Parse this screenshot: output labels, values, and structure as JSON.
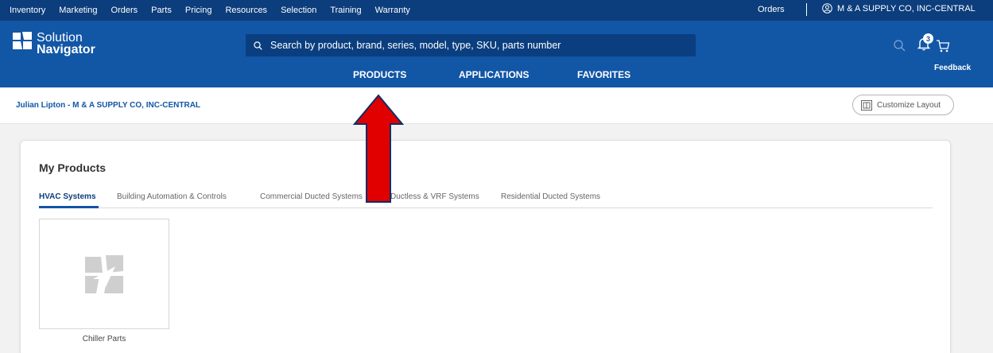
{
  "topbar": {
    "nav": [
      "Inventory",
      "Marketing",
      "Orders",
      "Parts",
      "Pricing",
      "Resources",
      "Selection",
      "Training",
      "Warranty"
    ],
    "orders": "Orders",
    "user_company": "M & A SUPPLY CO, INC-CENTRAL",
    "user_icon": "user-circle-icon"
  },
  "logo": {
    "line1": "Solution",
    "line2": "Navigator"
  },
  "search": {
    "placeholder": "Search by product, brand, series, model, type, SKU, parts number",
    "icon": "search-icon"
  },
  "mainnav": [
    "PRODUCTS",
    "APPLICATIONS",
    "FAVORITES"
  ],
  "header_icons": {
    "notification_count": "3",
    "feedback": "Feedback"
  },
  "subheader": {
    "breadcrumb": "Julian Lipton - M & A SUPPLY CO, INC-CENTRAL",
    "customize_label": "Customize Layout"
  },
  "products": {
    "title": "My Products",
    "tabs": [
      "HVAC Systems",
      "Building Automation & Controls",
      "Commercial Ducted Systems",
      "Ductless & VRF Systems",
      "Residential Ducted Systems"
    ],
    "active_tab": "HVAC Systems",
    "tiles": [
      {
        "label": "Chiller Parts",
        "icon": "product-placeholder-icon"
      }
    ]
  },
  "colors": {
    "topbar": "#0c3d7c",
    "header": "#1256a6",
    "annotation_arrow": "#e00000"
  }
}
